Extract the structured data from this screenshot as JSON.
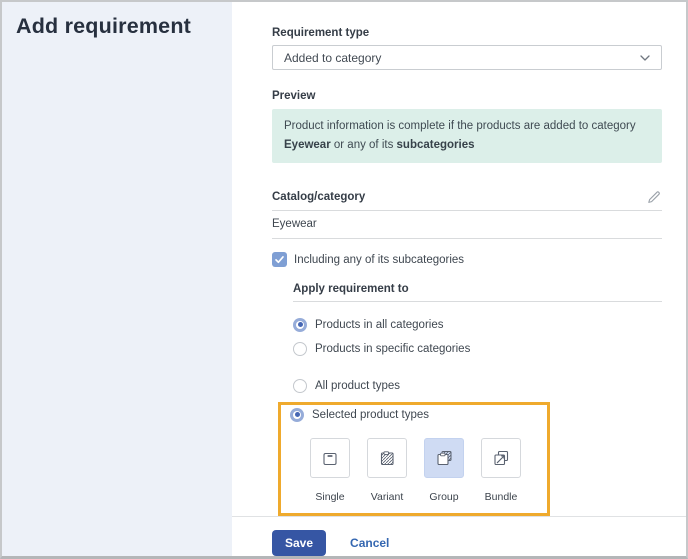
{
  "sidebar": {
    "title": "Add requirement"
  },
  "form": {
    "requirement_type": {
      "label": "Requirement type",
      "value": "Added to category"
    },
    "preview": {
      "label": "Preview",
      "p1": "Product information is complete if the products are added to category ",
      "b1": "Eyewear",
      "p2": " or any of its ",
      "b2": "subcategories"
    },
    "catalog": {
      "label": "Catalog/category",
      "value": "Eyewear"
    },
    "subcategories_checkbox": {
      "label": "Including any of its subcategories",
      "checked": true
    },
    "apply": {
      "heading": "Apply requirement to",
      "category_options": [
        {
          "label": "Products in all categories",
          "selected": true
        },
        {
          "label": "Products in specific categories",
          "selected": false
        }
      ],
      "type_options": [
        {
          "label": "All product types",
          "selected": false
        },
        {
          "label": "Selected product types",
          "selected": true
        }
      ]
    },
    "product_types": {
      "items": [
        {
          "label": "Single",
          "selected": false
        },
        {
          "label": "Variant",
          "selected": false
        },
        {
          "label": "Group",
          "selected": true
        },
        {
          "label": "Bundle",
          "selected": false
        }
      ]
    }
  },
  "footer": {
    "save_label": "Save",
    "cancel_label": "Cancel"
  },
  "colors": {
    "sidebar_bg": "#edf1f8",
    "preview_bg": "#dcefe9",
    "highlight_orange": "#efaa2d",
    "accent_blue": "#3656a4",
    "checkbox_blue": "#7f9fd4",
    "selected_tile_bg": "#cfdbf3"
  }
}
